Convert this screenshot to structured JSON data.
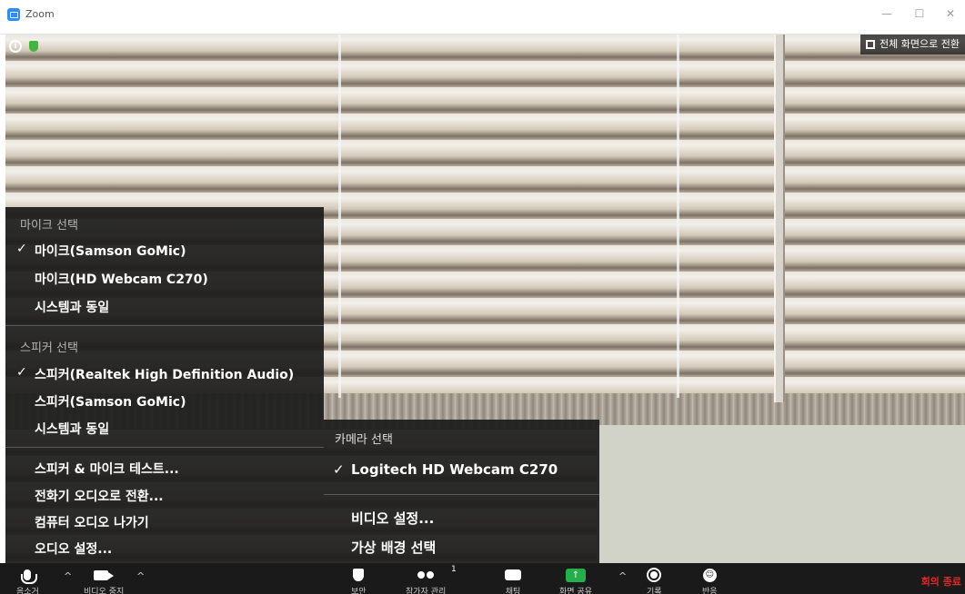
{
  "window": {
    "title": "Zoom",
    "minimize_glyph": "—",
    "maximize_glyph": "☐",
    "close_glyph": "✕"
  },
  "video": {
    "fullscreen_label": "전체 화면으로 전환",
    "info_glyph": "i"
  },
  "audio_menu": {
    "mic_header": "마이크 선택",
    "mic_items": [
      "마이크(Samson GoMic)",
      "마이크(HD Webcam C270)",
      "시스템과 동일"
    ],
    "mic_selected_index": 0,
    "speaker_header": "스피커 선택",
    "speaker_items": [
      "스피커(Realtek High Definition Audio)",
      "스피커(Samson GoMic)",
      "시스템과 동일"
    ],
    "speaker_selected_index": 0,
    "actions": [
      "스피커 & 마이크 테스트...",
      "전화기 오디오로 전환...",
      "컴퓨터 오디오 나가기",
      "오디오 설정..."
    ],
    "check_glyph": "✓"
  },
  "video_menu": {
    "camera_header": "카메라 선택",
    "camera_items": [
      "Logitech HD Webcam C270"
    ],
    "camera_selected_index": 0,
    "actions": [
      "비디오 설정...",
      "가상 배경 선택"
    ],
    "check_glyph": "✓"
  },
  "toolbar": {
    "mute_label": "음소거",
    "stop_video_label": "비디오 중지",
    "security_label": "보안",
    "participants_label": "참가자 관리",
    "participants_count": "1",
    "chat_label": "채팅",
    "share_label": "화면 공유",
    "share_glyph": "↑",
    "record_label": "기록",
    "reactions_label": "반응",
    "reactions_glyph": "☺",
    "caret_glyph": "^",
    "end_label": "회의 종료"
  }
}
